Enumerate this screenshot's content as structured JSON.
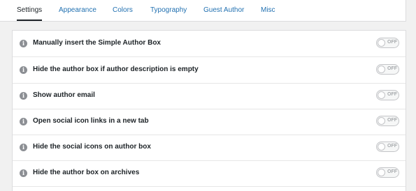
{
  "tabs": [
    {
      "label": "Settings",
      "active": true
    },
    {
      "label": "Appearance"
    },
    {
      "label": "Colors"
    },
    {
      "label": "Typography"
    },
    {
      "label": "Guest Author"
    },
    {
      "label": "Misc"
    }
  ],
  "info_glyph": "i",
  "toggle_off_label": "OFF",
  "settings": [
    {
      "label": "Manually insert the Simple Author Box",
      "enabled": false
    },
    {
      "label": "Hide the author box if author description is empty",
      "enabled": false
    },
    {
      "label": "Show author email",
      "enabled": false
    },
    {
      "label": "Open social icon links in a new tab",
      "enabled": false
    },
    {
      "label": "Hide the social icons on author box",
      "enabled": false
    },
    {
      "label": "Hide the author box on archives",
      "enabled": false
    }
  ],
  "colors": {
    "link": "#2271b1",
    "active_tab": "#1d2327",
    "toggle_off": "#a7aaad"
  }
}
